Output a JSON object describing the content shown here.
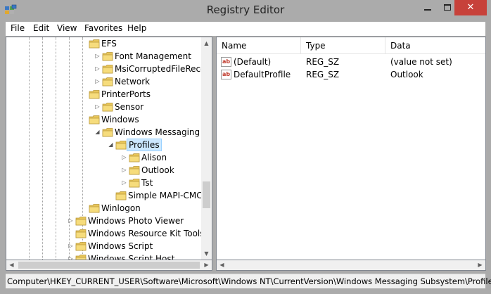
{
  "window": {
    "title": "Registry Editor",
    "icon": "regedit-icon",
    "controls": {
      "minimize": "minimize-icon",
      "maximize": "maximize-icon",
      "close": "✕"
    }
  },
  "menu": [
    "File",
    "Edit",
    "View",
    "Favorites",
    "Help"
  ],
  "tree": {
    "items": [
      {
        "label": "EFS",
        "expander": ""
      },
      {
        "label": "Font Management",
        "expander": "▷"
      },
      {
        "label": "MsiCorruptedFileReco",
        "expander": "▷"
      },
      {
        "label": "Network",
        "expander": "▷"
      },
      {
        "label": "PrinterPorts",
        "expander": ""
      },
      {
        "label": "Sensor",
        "expander": "▷"
      },
      {
        "label": "Windows",
        "expander": ""
      },
      {
        "label": "Windows Messaging S",
        "expander": "◢"
      },
      {
        "label": "Profiles",
        "expander": "◢",
        "selected": true
      },
      {
        "label": "Alison",
        "expander": "▷"
      },
      {
        "label": "Outlook",
        "expander": "▷"
      },
      {
        "label": "Tst",
        "expander": "▷"
      },
      {
        "label": "Simple MAPI-CMC",
        "expander": ""
      },
      {
        "label": "Winlogon",
        "expander": ""
      },
      {
        "label": "Windows Photo Viewer",
        "expander": "▷"
      },
      {
        "label": "Windows Resource Kit Tools",
        "expander": ""
      },
      {
        "label": "Windows Script",
        "expander": "▷"
      },
      {
        "label": "Windows Script Host",
        "expander": "▷"
      }
    ]
  },
  "list": {
    "columns": [
      "Name",
      "Type",
      "Data"
    ],
    "rows": [
      {
        "name": "(Default)",
        "type": "REG_SZ",
        "data": "(value not set)"
      },
      {
        "name": "DefaultProfile",
        "type": "REG_SZ",
        "data": "Outlook"
      }
    ],
    "value_icon": "ab"
  },
  "status": {
    "path": "Computer\\HKEY_CURRENT_USER\\Software\\Microsoft\\Windows NT\\CurrentVersion\\Windows Messaging Subsystem\\Profiles"
  },
  "colors": {
    "folder": "#e8c65a",
    "selection": "#cce8ff",
    "close": "#c7413a"
  }
}
